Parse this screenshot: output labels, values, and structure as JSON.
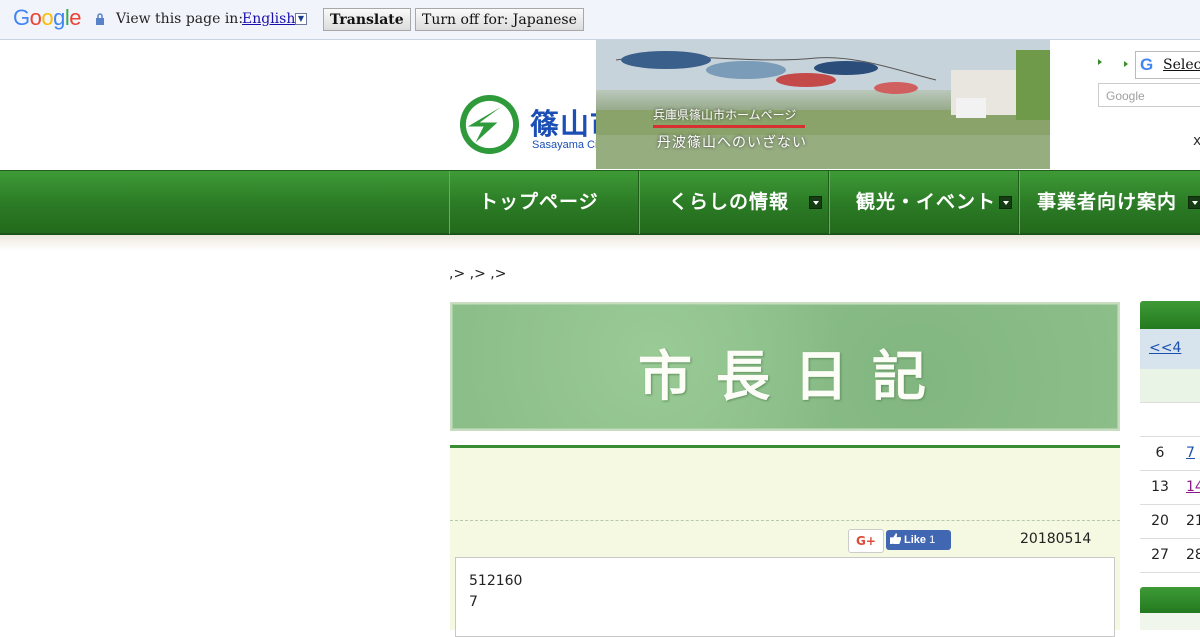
{
  "translate_bar": {
    "logo": "Google",
    "view_text": "View this page in:",
    "language": "English",
    "translate_button": "Translate",
    "turn_off_button": "Turn off for: Japanese"
  },
  "header": {
    "logo_jp": "篠山市",
    "logo_en": "Sasayama City",
    "banner_caption1": "兵庫県篠山市ホームページ",
    "banner_caption2": "丹波篠山へのいざない",
    "select_language": "Selec",
    "search_placeholder": "Google",
    "close_mark": "x"
  },
  "nav": {
    "items": [
      {
        "label": "トップページ"
      },
      {
        "label": "くらしの情報"
      },
      {
        "label": "観光・イベント"
      },
      {
        "label": "事業者向け案内"
      }
    ]
  },
  "breadcrumb": ",> ,> ,>",
  "title": "市長日記",
  "article": {
    "gplus_label": "G+",
    "like_label": "Like",
    "like_count": "1",
    "date": "20180514",
    "body_line1": "512160",
    "body_line2": "7"
  },
  "calendar": {
    "prev_link": "<<4",
    "rows": [
      {
        "d1": "6",
        "d2": "7"
      },
      {
        "d1": "13",
        "d2": "14"
      },
      {
        "d1": "20",
        "d2": "21"
      },
      {
        "d1": "27",
        "d2": "28"
      }
    ]
  }
}
